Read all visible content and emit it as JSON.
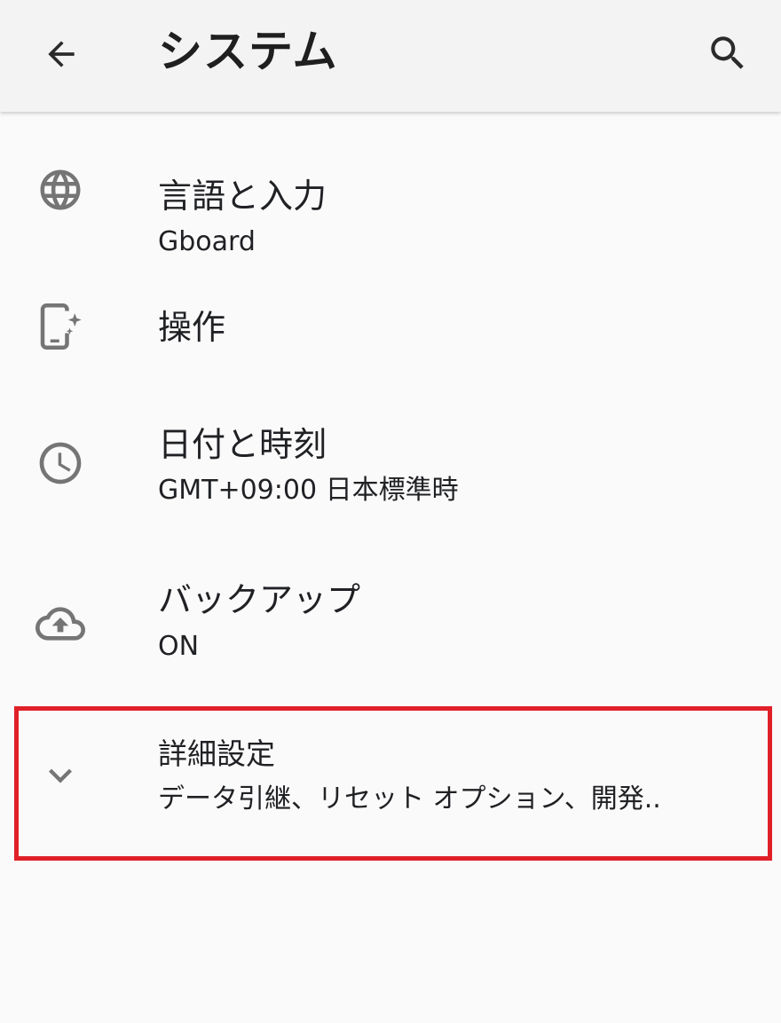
{
  "app_bar": {
    "title": "システム",
    "back_icon": "arrow-back-icon",
    "search_icon": "search-icon"
  },
  "settings": [
    {
      "id": "languages",
      "icon": "globe-icon",
      "title": "言語と入力",
      "summary": "Gboard"
    },
    {
      "id": "gestures",
      "icon": "phone-sparkle-icon",
      "title": "操作",
      "summary": ""
    },
    {
      "id": "date-time",
      "icon": "clock-icon",
      "title": "日付と時刻",
      "summary": "GMT+09:00 日本標準時"
    },
    {
      "id": "backup",
      "icon": "cloud-upload-icon",
      "title": "バックアップ",
      "summary": "ON"
    },
    {
      "id": "advanced",
      "icon": "chevron-down-icon",
      "title": "詳細設定",
      "summary": "データ引継、リセット オプション、開発.."
    }
  ],
  "colors": {
    "background": "#fafafa",
    "app_bar": "#f3f3f3",
    "icon": "#757575",
    "highlight": "#e02028"
  }
}
